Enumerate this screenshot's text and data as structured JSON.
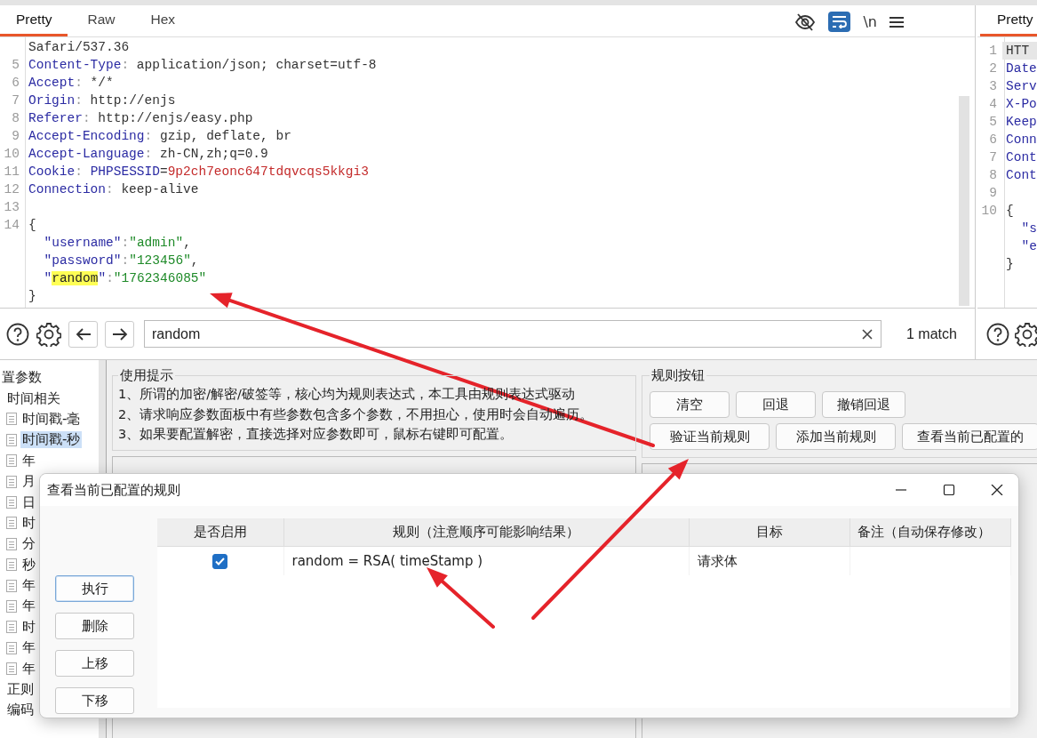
{
  "request_editor": {
    "tabs": [
      {
        "label": "Pretty",
        "selected": true
      },
      {
        "label": "Raw",
        "selected": false
      },
      {
        "label": "Hex",
        "selected": false
      }
    ],
    "toolbar": {
      "wrap_on": true,
      "newline_label": "\\n"
    },
    "lines": [
      {
        "indented": false,
        "segments": [
          {
            "kind": "text",
            "text": "Safari/537.36"
          }
        ]
      },
      {
        "number": "5",
        "indented": false,
        "segments": [
          {
            "kind": "name",
            "text": "Content-Type"
          },
          {
            "kind": "punct",
            "text": ":"
          },
          {
            "kind": "text",
            "text": " application/json; charset=utf-8"
          }
        ]
      },
      {
        "number": "6",
        "indented": false,
        "segments": [
          {
            "kind": "name",
            "text": "Accept"
          },
          {
            "kind": "punct",
            "text": ":"
          },
          {
            "kind": "text",
            "text": " */*"
          }
        ]
      },
      {
        "number": "7",
        "indented": false,
        "segments": [
          {
            "kind": "name",
            "text": "Origin"
          },
          {
            "kind": "punct",
            "text": ":"
          },
          {
            "kind": "text",
            "text": " http://enjs"
          }
        ]
      },
      {
        "number": "8",
        "indented": false,
        "segments": [
          {
            "kind": "name",
            "text": "Referer"
          },
          {
            "kind": "punct",
            "text": ":"
          },
          {
            "kind": "text",
            "text": " http://enjs/easy.php"
          }
        ]
      },
      {
        "number": "9",
        "indented": false,
        "segments": [
          {
            "kind": "name",
            "text": "Accept-Encoding"
          },
          {
            "kind": "punct",
            "text": ":"
          },
          {
            "kind": "text",
            "text": " gzip, deflate, br"
          }
        ]
      },
      {
        "number": "10",
        "indented": false,
        "segments": [
          {
            "kind": "name",
            "text": "Accept-Language"
          },
          {
            "kind": "punct",
            "text": ":"
          },
          {
            "kind": "text",
            "text": " zh-CN,zh;q=0.9"
          }
        ]
      },
      {
        "number": "11",
        "indented": false,
        "segments": [
          {
            "kind": "name",
            "text": "Cookie"
          },
          {
            "kind": "punct",
            "text": ": "
          },
          {
            "kind": "name",
            "text": "PHPSESSID"
          },
          {
            "kind": "text",
            "text": "="
          },
          {
            "kind": "value",
            "text": "9p2ch7eonc647tdqvcqs5kkgi3"
          }
        ]
      },
      {
        "number": "12",
        "indented": false,
        "segments": [
          {
            "kind": "name",
            "text": "Connection"
          },
          {
            "kind": "punct",
            "text": ":"
          },
          {
            "kind": "text",
            "text": " keep-alive"
          }
        ]
      },
      {
        "number": "13",
        "indented": false
      },
      {
        "number": "14",
        "indented": false,
        "segments": [
          {
            "kind": "text",
            "text": "{"
          }
        ]
      },
      {
        "indented": true,
        "segments": [
          {
            "kind": "name",
            "text": "\"username\""
          },
          {
            "kind": "punct",
            "text": ":"
          },
          {
            "kind": "string",
            "text": "\"admin\""
          },
          {
            "kind": "text",
            "text": ","
          }
        ]
      },
      {
        "indented": true,
        "segments": [
          {
            "kind": "name",
            "text": "\"password\""
          },
          {
            "kind": "punct",
            "text": ":"
          },
          {
            "kind": "string",
            "text": "\"123456\""
          },
          {
            "kind": "text",
            "text": ","
          }
        ]
      },
      {
        "indented": true,
        "segments": [
          {
            "kind": "name",
            "text": "\""
          },
          {
            "kind": "match",
            "text": "random"
          },
          {
            "kind": "name",
            "text": "\""
          },
          {
            "kind": "punct",
            "text": ":"
          },
          {
            "kind": "string",
            "text": "\"1762346085\""
          }
        ]
      },
      {
        "indented": false,
        "segments": [
          {
            "kind": "text",
            "text": "}"
          }
        ]
      }
    ],
    "search": {
      "value": "random",
      "matches": "1 match"
    }
  },
  "response_editor": {
    "tabs": [
      {
        "label": "Pretty",
        "selected": true
      }
    ],
    "lines": [
      {
        "number": "1",
        "current": true,
        "indented": false,
        "segments": [
          {
            "kind": "text",
            "text": "HTT"
          }
        ]
      },
      {
        "number": "2",
        "current": false,
        "indented": false,
        "segments": [
          {
            "kind": "name",
            "text": "Date"
          }
        ]
      },
      {
        "number": "3",
        "current": false,
        "indented": false,
        "segments": [
          {
            "kind": "name",
            "text": "Serv"
          }
        ]
      },
      {
        "number": "4",
        "current": false,
        "indented": false,
        "segments": [
          {
            "kind": "name",
            "text": "X-Po"
          }
        ]
      },
      {
        "number": "5",
        "current": false,
        "indented": false,
        "segments": [
          {
            "kind": "name",
            "text": "Keep"
          }
        ]
      },
      {
        "number": "6",
        "current": false,
        "indented": false,
        "segments": [
          {
            "kind": "name",
            "text": "Conn"
          }
        ]
      },
      {
        "number": "7",
        "current": false,
        "indented": false,
        "segments": [
          {
            "kind": "name",
            "text": "Cont"
          }
        ]
      },
      {
        "number": "8",
        "current": false,
        "indented": false,
        "segments": [
          {
            "kind": "name",
            "text": "Cont"
          }
        ]
      },
      {
        "number": "9",
        "current": false,
        "indented": false
      },
      {
        "number": "10",
        "current": false,
        "indented": false,
        "segments": [
          {
            "kind": "text",
            "text": "{"
          }
        ]
      },
      {
        "current": false,
        "indented": true,
        "segments": [
          {
            "kind": "name",
            "text": "\"s"
          }
        ]
      },
      {
        "current": false,
        "indented": true,
        "segments": [
          {
            "kind": "name",
            "text": "\"e"
          }
        ]
      },
      {
        "current": false,
        "indented": false,
        "segments": [
          {
            "kind": "text",
            "text": "}"
          }
        ]
      }
    ]
  },
  "tree": {
    "items": [
      {
        "label": "置参数",
        "selected": false,
        "children": [
          {
            "label": "时间相关",
            "selected": false,
            "children": [
              {
                "label": "时间戳-毫",
                "selected": false
              },
              {
                "label": "时间戳-秒",
                "selected": true
              },
              {
                "label": "年",
                "selected": false
              },
              {
                "label": "月",
                "selected": false
              },
              {
                "label": "日",
                "selected": false
              },
              {
                "label": "时",
                "selected": false
              },
              {
                "label": "分",
                "selected": false
              },
              {
                "label": "秒",
                "selected": false
              },
              {
                "label": "年",
                "selected": false
              },
              {
                "label": "年",
                "selected": false
              },
              {
                "label": "时",
                "selected": false
              },
              {
                "label": "年",
                "selected": false
              },
              {
                "label": "年",
                "selected": false
              }
            ]
          },
          {
            "label": "正则",
            "selected": false
          },
          {
            "label": "编码",
            "selected": false
          }
        ]
      }
    ]
  },
  "hints": {
    "title": "使用提示",
    "lines": [
      "1、所谓的加密/解密/破签等，核心均为规则表达式，本工具由规则表达式驱动",
      "2、请求响应参数面板中有些参数包含多个参数，不用担心，使用时会自动遍历。",
      "3、如果要配置解密，直接选择对应参数即可，鼠标右键即可配置。"
    ]
  },
  "rule_buttons": {
    "title": "规则按钮",
    "buttons": [
      {
        "label": "清空",
        "kind": "small"
      },
      {
        "label": "回退",
        "kind": "small"
      },
      {
        "label": "撤销回退",
        "kind": "small"
      },
      {
        "label": "验证当前规则",
        "kind": "wide"
      },
      {
        "label": "添加当前规则",
        "kind": "wide"
      },
      {
        "label": "查看当前已配置的",
        "kind": "wide"
      }
    ]
  },
  "dialog": {
    "title": "查看当前已配置的规则",
    "buttons": [
      {
        "label": "执行",
        "focused": true
      },
      {
        "label": "删除",
        "focused": false
      },
      {
        "label": "上移",
        "focused": false
      },
      {
        "label": "下移",
        "focused": false
      }
    ],
    "columns": [
      "是否启用",
      "规则（注意顺序可能影响结果）",
      "目标",
      "备注（自动保存修改）"
    ],
    "rows": [
      {
        "enabled": true,
        "rule": "random = RSA( timeStamp )",
        "target": "请求体"
      }
    ]
  }
}
